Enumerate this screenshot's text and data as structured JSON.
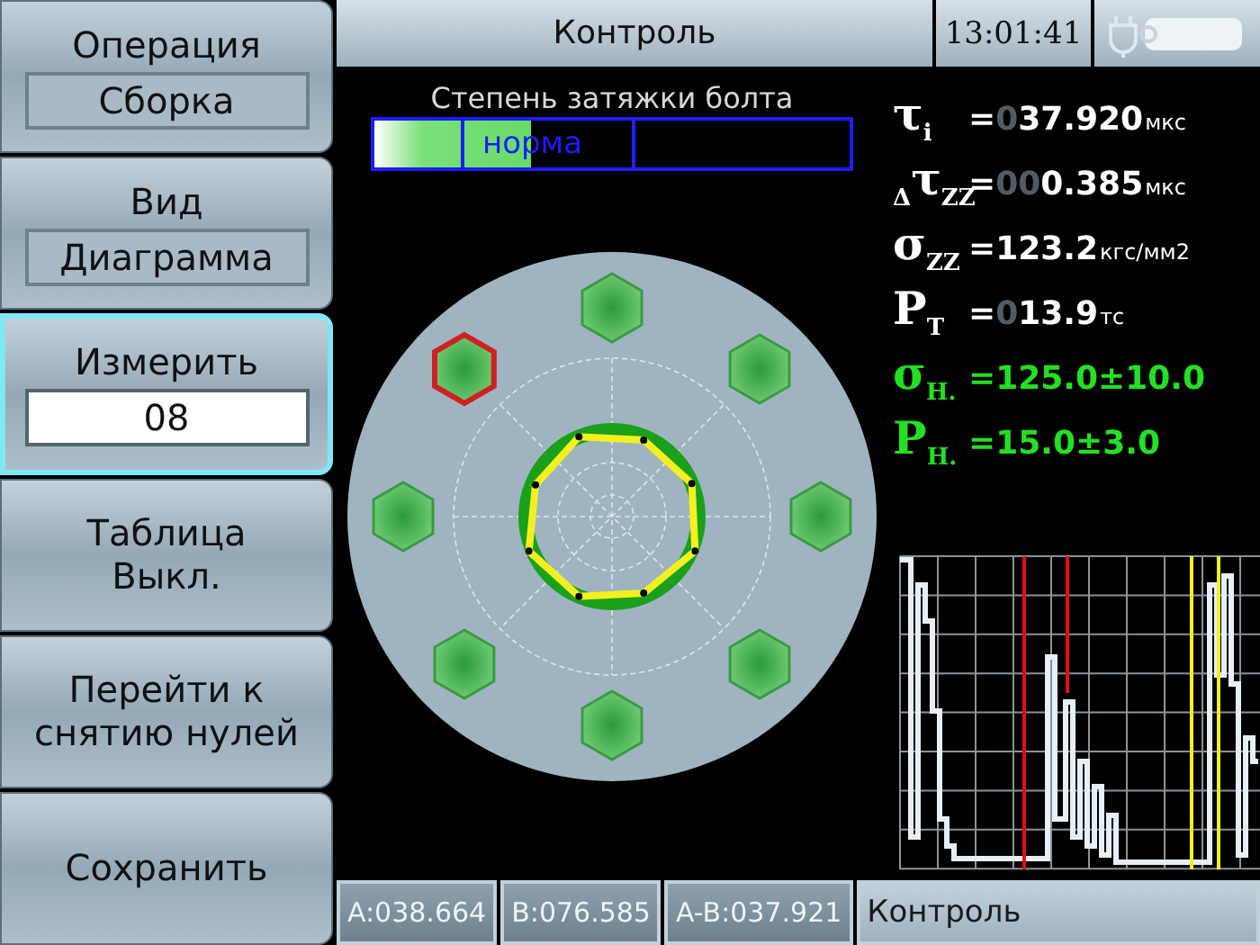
{
  "menu": [
    {
      "kind": "select",
      "label": "Операция",
      "value": "Сборка",
      "selected": false
    },
    {
      "kind": "select",
      "label": "Вид",
      "value": "Диаграмма",
      "selected": false
    },
    {
      "kind": "input",
      "label": "Измерить",
      "value": "08",
      "selected": true
    },
    {
      "kind": "plain",
      "label": "Таблица\nВыкл.",
      "selected": false
    },
    {
      "kind": "plain",
      "label": "Перейти к\nснятию нулей",
      "selected": false
    },
    {
      "kind": "plain",
      "label": "Сохранить",
      "selected": false
    }
  ],
  "header": {
    "title": "Контроль",
    "time": "13:01:41"
  },
  "tightness": {
    "title": "Степень затяжки болта",
    "label": "норма",
    "level": 0.33
  },
  "bolts": [
    {
      "faulty": false
    },
    {
      "faulty": false
    },
    {
      "faulty": false
    },
    {
      "faulty": false
    },
    {
      "faulty": false
    },
    {
      "faulty": false
    },
    {
      "faulty": false
    },
    {
      "faulty": true
    }
  ],
  "readouts": [
    {
      "kind": "measured",
      "symbol": "τ$_{i}$",
      "eq": "=",
      "lead": "0",
      "value": "37.920",
      "unit": "мкс"
    },
    {
      "kind": "measured",
      "symbol": "$_{Δ}$τ$_{ZZ}$",
      "eq": "=",
      "lead": "00",
      "value": "0.385",
      "unit": "мкс"
    },
    {
      "kind": "measured",
      "symbol": "σ$_{ZZ}$",
      "eq": "=",
      "value": "123.2",
      "unit": "кгс/мм2"
    },
    {
      "kind": "measured",
      "symbol": "P$_{T}$",
      "eq": "=",
      "lead": "0",
      "value": "13.9",
      "unit": "тс"
    },
    {
      "kind": "nominal",
      "symbol": "σ$_{Н.}$",
      "eq": "=",
      "value": "125.0±10.0"
    },
    {
      "kind": "nominal",
      "symbol": "P$_{Н.}$",
      "eq": "=",
      "value": "15.0±3.0"
    }
  ],
  "status_bar": [
    "A:038.664",
    "B:076.585",
    "A-B:037.921",
    "Контроль"
  ]
}
